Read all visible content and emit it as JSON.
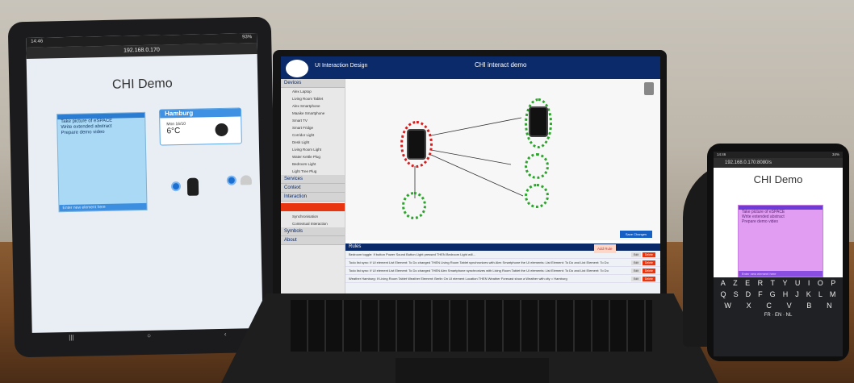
{
  "tablet": {
    "status_time": "14:46",
    "status_right": "93%",
    "url": "192.168.0.170",
    "title": "CHI Demo",
    "todo_items": [
      "Take picture of eSPACE",
      "Write extended abstract",
      "Prepare demo video"
    ],
    "todo_footer": "Enter new element here",
    "weather_city": "Hamburg",
    "weather_date": "Mon 16/10",
    "weather_temp": "6°C"
  },
  "laptop": {
    "header_left": "UI Interaction Design",
    "header_title": "CHI interact demo",
    "sidebar_devices": "Devices",
    "devices": [
      "Alex Laptop",
      "Living Room Tablet",
      "Alex Smartphone",
      "Maaike Smartphone",
      "Smart TV",
      "Smart Fridge",
      "Corridor Light",
      "Desk Light",
      "Living Room Light",
      "Water Kettle Plug",
      "Bedroom Light",
      "Light Tree Plug"
    ],
    "sections": [
      "Services",
      "Context",
      "Interaction"
    ],
    "interactions": [
      "Synchronisation",
      "Contextual Interaction"
    ],
    "other_sections": [
      "Symbols",
      "About"
    ],
    "save_label": "Save Changes",
    "rules_label": "Rules",
    "add_rule": "Add Rule",
    "rules": [
      "Bedroom toggle:  If button Power Sound Button Light pressed THEN Bedroom Light will...",
      "Todo list sync:  If UI element List Element: To Do changed THEN Living Room Tablet synchronizes with Alex Smartphone the UI elements: List Element: To Do and List Element: To Do",
      "Todo list sync:  If UI element List Element: To Do changed THEN Alex Smartphone synchronizes with Living Room Tablet the UI elements: List Element: To Do and List Element: To Do",
      "Weather Hamburg:  If Living Room Tablet Weather Element: Berlin On UI element Location THEN Weather Forecast show a Weather with city = Hamburg"
    ],
    "edit_label": "Edit",
    "delete_label": "Delete"
  },
  "phone": {
    "status_time": "14:46",
    "status_right": "34%",
    "url": "192.168.0.170:8080/s",
    "title": "CHI Demo",
    "todo_items": [
      "Take picture of eSPACE",
      "Write extended abstract",
      "Prepare demo video"
    ],
    "todo_footer": "Enter new element here",
    "kb_row1": [
      "A",
      "Z",
      "E",
      "R",
      "T",
      "Y",
      "U",
      "I",
      "O",
      "P"
    ],
    "kb_row2": [
      "Q",
      "S",
      "D",
      "F",
      "G",
      "H",
      "J",
      "K",
      "L",
      "M"
    ],
    "kb_row3": [
      "W",
      "X",
      "C",
      "V",
      "B",
      "N"
    ],
    "kb_lang": "FR · EN · NL"
  },
  "colors": {
    "accent": "#0b2a6a",
    "alert": "#e8350f",
    "green": "#2aa52a",
    "red": "#d61e1e"
  }
}
